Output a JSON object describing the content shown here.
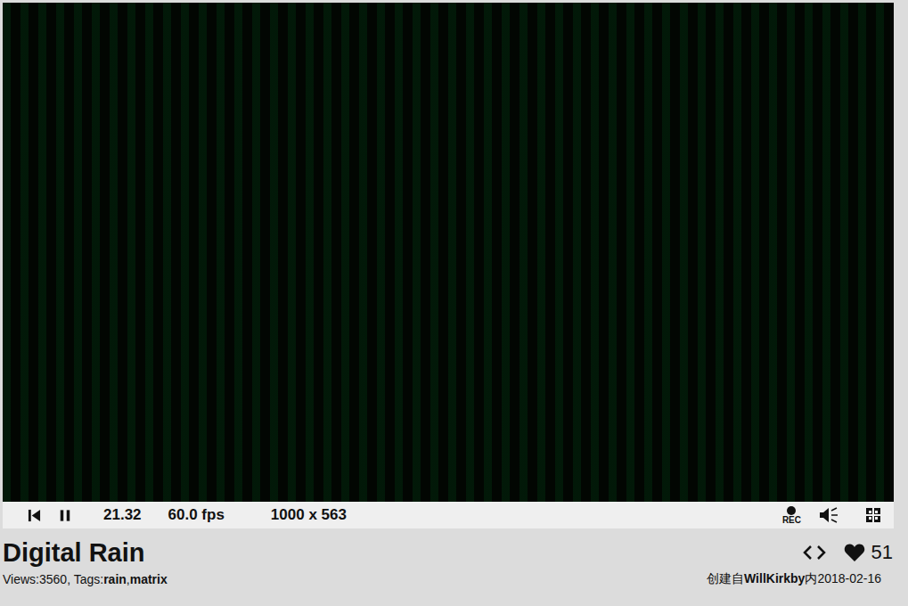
{
  "player": {
    "time": "21.32",
    "fps": "60.0 fps",
    "resolution": "1000 x 563",
    "rec_label": "REC",
    "playing": true
  },
  "shader": {
    "title": "Digital Rain",
    "likes": "51",
    "views_label": "Views:",
    "views": "3560",
    "tags_label": ", Tags:",
    "tags": [
      "rain",
      "matrix"
    ],
    "tag_separator": ",",
    "created_prefix": "创建自",
    "author": "WillKirkby",
    "created_mid": "内",
    "date": "2018-02-16"
  }
}
